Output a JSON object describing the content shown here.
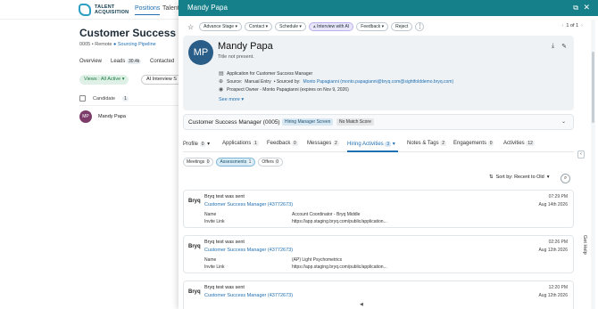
{
  "brand": {
    "line1": "TALENT",
    "line2": "ACQUISITION"
  },
  "top_nav": [
    "Positions",
    "Talent"
  ],
  "position": {
    "title": "Customer Success Mc",
    "code": "0005",
    "mode": "Remote",
    "status": "Sourcing Pipeline"
  },
  "bg_tabs": [
    {
      "label": "Overview",
      "count": ""
    },
    {
      "label": "Leads",
      "count": "30.4k"
    },
    {
      "label": "Contacted",
      "count": ""
    }
  ],
  "bg_view_label": "Views : All Active",
  "bg_ai_label": "AI Interview S",
  "candidate_header": {
    "label": "Candidate",
    "count": "1"
  },
  "candidate_row": {
    "initials": "MP",
    "name": "Mandy Papa"
  },
  "drawer": {
    "header_name": "Mandy Papa",
    "actions": [
      "Advance Stage",
      "Contact",
      "Schedule",
      "Interview with AI",
      "Feedback",
      "Reject"
    ],
    "pager": "1 of 1"
  },
  "profile": {
    "initials": "MP",
    "name": "Mandy Papa",
    "title": "Title not present.",
    "application": "Application for Customer Success Manager",
    "source_prefix": "Source:",
    "source_value": "Manual Entry",
    "sourced_by_prefix": "• Sourced by:",
    "sourced_by_value": "Monto Papagianni (monto.papagianni@bryq.com@sightfolddemo.bryq.com)",
    "prospect_owner": "Prospect Owner - Monto Papagianni (expires on Nov 9, 2026)",
    "see_more": "See more"
  },
  "job_card": {
    "title": "Customer Success Manager (0005)",
    "badge_screen": "Hiring Manager Screen",
    "badge_match": "No Match Score"
  },
  "tabs": [
    {
      "label": "Profile",
      "count": "0"
    },
    {
      "label": "Applications",
      "count": "1"
    },
    {
      "label": "Feedback",
      "count": "0"
    },
    {
      "label": "Messages",
      "count": "2"
    },
    {
      "label": "Hiring Activities",
      "count": "3"
    },
    {
      "label": "Notes & Tags",
      "count": "2"
    },
    {
      "label": "Engagements",
      "count": "0"
    },
    {
      "label": "Activities",
      "count": "12"
    }
  ],
  "subtabs": [
    {
      "label": "Meetings",
      "count": "0"
    },
    {
      "label": "Assessments",
      "count": "1"
    },
    {
      "label": "Offers",
      "count": "0"
    }
  ],
  "sort_label": "Sort by: Recent to Old",
  "cards": [
    {
      "logo": "Bryq",
      "title": "Bryq test was sent",
      "job": "Customer Success Manager (43772673)",
      "name_label": "Name",
      "name_value": "Account Coordinator - Bryq Middle",
      "invite_label": "Invite Link",
      "invite_value": "https://app.staging.bryq.com/public/application...",
      "time": "07:29 PM",
      "date": "Aug 14th 2026"
    },
    {
      "logo": "Bryq",
      "title": "Bryq test was sent",
      "job": "Customer Success Manager (43772673)",
      "name_label": "Name",
      "name_value": "(AP) Light Psychometrics",
      "invite_label": "Invite Link",
      "invite_value": "https://app.staging.bryq.com/public/application...",
      "time": "02:26 PM",
      "date": "Aug 12th 2026"
    },
    {
      "logo": "Bryq",
      "title": "Bryq test was sent",
      "job": "Customer Success Manager (43772673)",
      "time": "12:20 PM",
      "date": "Aug 12th 2026"
    }
  ],
  "help_label": "Get Help",
  "colors": {
    "header": "#15808a",
    "link": "#1f6fb2",
    "avatar": "#2a5d87"
  }
}
